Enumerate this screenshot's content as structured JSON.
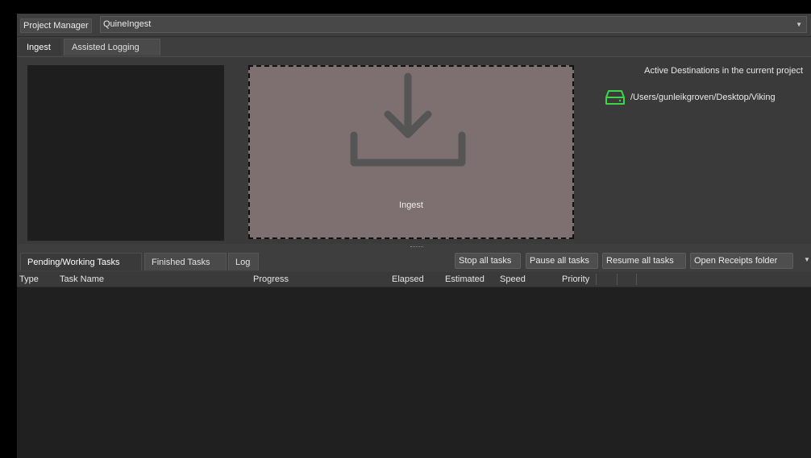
{
  "topbar": {
    "project_manager_label": "Project Manager",
    "project_name": "QuineIngest",
    "caret": "▼"
  },
  "top_tabs": [
    "Ingest",
    "Assisted Logging"
  ],
  "ingest": {
    "drop_label": "Ingest",
    "destinations_title": "Active Destinations in the current project",
    "destination_path": "/Users/gunleikgroven/Desktop/Viking",
    "destination_icon": "drive-icon",
    "destination_icon_color": "#3dd44a",
    "drop_zone_color": "#7e7070"
  },
  "task_tabs": [
    "Pending/Working Tasks",
    "Finished Tasks",
    "Log"
  ],
  "buttons": {
    "stop_all": "Stop all tasks",
    "pause_all": "Pause all tasks",
    "resume_all": "Resume all tasks",
    "open_receipts": "Open Receipts folder",
    "more_caret": "▼"
  },
  "table": {
    "columns": [
      "Type",
      "Task Name",
      "Progress",
      "Elapsed",
      "Estimated",
      "Speed",
      "Priority"
    ],
    "rows": []
  }
}
